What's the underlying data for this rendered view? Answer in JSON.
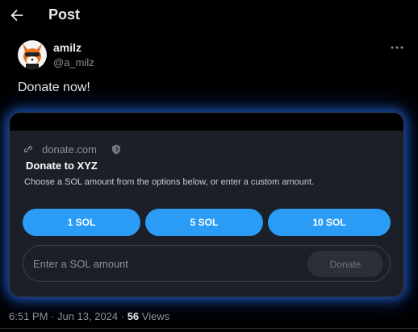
{
  "header": {
    "title": "Post",
    "back_icon": "arrow-left-icon"
  },
  "author": {
    "name": "amilz",
    "handle": "@a_milz",
    "avatar_icon": "fox-avatar",
    "more_icon": "ellipsis-icon"
  },
  "post": {
    "text": "Donate now!"
  },
  "card": {
    "domain": "donate.com",
    "link_icon": "link-icon",
    "verified_icon": "shield-icon",
    "title": "Donate to XYZ",
    "description": "Choose a SOL amount from the options below, or enter a custom amount.",
    "amount_buttons": [
      {
        "label": "1 SOL"
      },
      {
        "label": "5 SOL"
      },
      {
        "label": "10 SOL"
      }
    ],
    "input": {
      "placeholder": "Enter a SOL amount",
      "value": ""
    },
    "submit_label": "Donate",
    "colors": {
      "button": "#2b9cf5",
      "glow": "#2878ff",
      "card_bg": "#1b1f27"
    }
  },
  "meta": {
    "timestamp": "6:51 PM · Jun 13, 2024 · ",
    "views_count": "56",
    "views_label": " Views"
  }
}
